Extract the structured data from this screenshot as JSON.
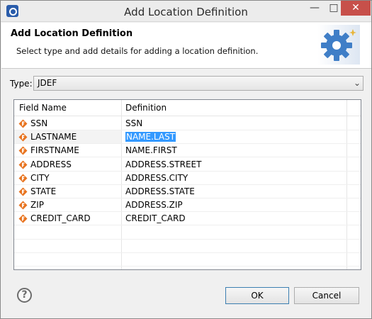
{
  "window": {
    "title": "Add Location Definition"
  },
  "header": {
    "title": "Add Location Definition",
    "description": "Select type and add details for adding a location definition."
  },
  "type": {
    "label": "Type:",
    "value": "JDEF"
  },
  "table": {
    "columns": [
      "Field Name",
      "Definition"
    ],
    "rows": [
      {
        "field": "SSN",
        "definition": "SSN"
      },
      {
        "field": "LASTNAME",
        "definition": "NAME.LAST",
        "selected": true
      },
      {
        "field": "FIRSTNAME",
        "definition": "NAME.FIRST"
      },
      {
        "field": "ADDRESS",
        "definition": "ADDRESS.STREET"
      },
      {
        "field": "CITY",
        "definition": "ADDRESS.CITY"
      },
      {
        "field": "STATE",
        "definition": "ADDRESS.STATE"
      },
      {
        "field": "ZIP",
        "definition": "ADDRESS.ZIP"
      },
      {
        "field": "CREDIT_CARD",
        "definition": "CREDIT_CARD"
      }
    ]
  },
  "buttons": {
    "help": "?",
    "ok": "OK",
    "cancel": "Cancel"
  },
  "colors": {
    "selection": "#3399ff",
    "field_icon": "#e8731e",
    "gear": "#3f7ec7"
  },
  "icons": {
    "field": "field-f-icon",
    "header": "gear-icon",
    "help": "help-icon"
  }
}
